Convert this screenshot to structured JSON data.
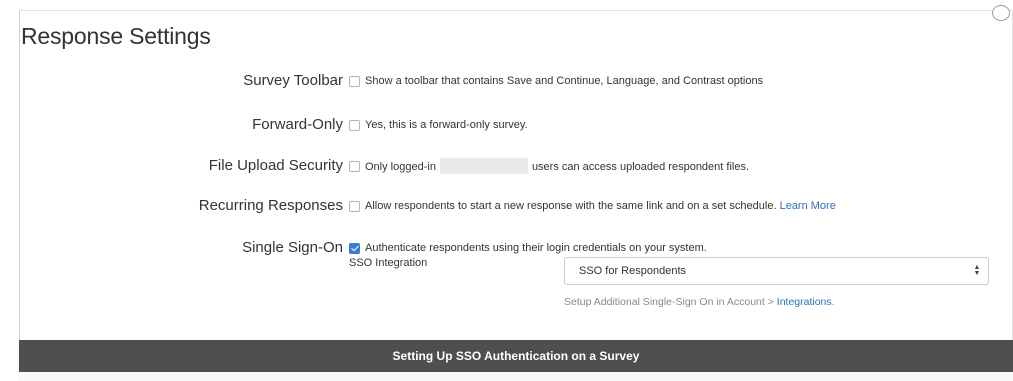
{
  "title": "Response Settings",
  "rows": [
    {
      "label": "Survey Toolbar",
      "checked": false,
      "text": "Show a toolbar that contains Save and Continue, Language, and Contrast options"
    },
    {
      "label": "Forward-Only",
      "checked": false,
      "text": "Yes, this is a forward-only survey."
    },
    {
      "label": "File Upload Security",
      "checked": false,
      "text_before": "Only logged-in",
      "text_after": "users can access uploaded respondent files."
    },
    {
      "label": "Recurring Responses",
      "checked": false,
      "text": "Allow respondents to start a new response with the same link and on a set schedule.",
      "link": "Learn More"
    },
    {
      "label": "Single Sign-On",
      "checked": true,
      "text": "Authenticate respondents using their login credentials on your system."
    }
  ],
  "sso": {
    "label": "SSO Integration",
    "selected": "SSO for Respondents",
    "helper_text": "Setup Additional Single-Sign On in Account > ",
    "helper_link": "Integrations",
    "helper_end": "."
  },
  "footer": {
    "caption": "Setting Up SSO Authentication on a Survey"
  },
  "colors": {
    "accent": "#3a7bd5",
    "link": "#2f6fba",
    "footer_bg": "#4f4f4f"
  }
}
